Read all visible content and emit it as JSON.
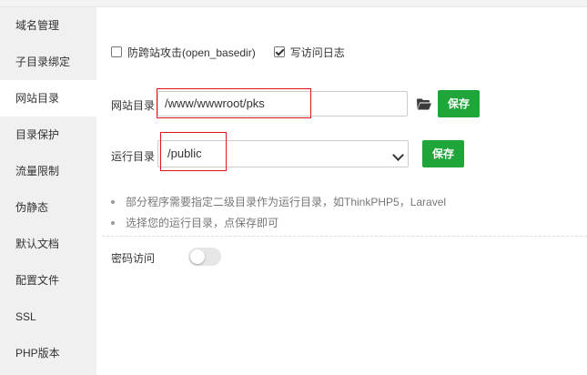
{
  "sidebar": {
    "items": [
      {
        "label": "域名管理",
        "active": false
      },
      {
        "label": "子目录绑定",
        "active": false
      },
      {
        "label": "网站目录",
        "active": true
      },
      {
        "label": "目录保护",
        "active": false
      },
      {
        "label": "流量限制",
        "active": false
      },
      {
        "label": "伪静态",
        "active": false
      },
      {
        "label": "默认文档",
        "active": false
      },
      {
        "label": "配置文件",
        "active": false
      },
      {
        "label": "SSL",
        "active": false
      },
      {
        "label": "PHP版本",
        "active": false
      }
    ]
  },
  "options": {
    "anti_cross_site": {
      "label": "防跨站攻击(open_basedir)",
      "checked": false
    },
    "access_log": {
      "label": "写访问日志",
      "checked": true
    }
  },
  "site_dir": {
    "label": "网站目录",
    "value": "/www/wwwroot/pks",
    "folder_icon": "folder-open-icon",
    "save_label": "保存"
  },
  "run_dir": {
    "label": "运行目录",
    "selected": "/public",
    "save_label": "保存"
  },
  "notes": [
    "部分程序需要指定二级目录作为运行目录，如ThinkPHP5，Laravel",
    "选择您的运行目录，点保存即可"
  ],
  "password_access": {
    "label": "密码访问",
    "enabled": false
  },
  "colors": {
    "accent_green": "#20a53a",
    "highlight_red": "#e0141b",
    "sidebar_bg": "#f0f0f0"
  }
}
